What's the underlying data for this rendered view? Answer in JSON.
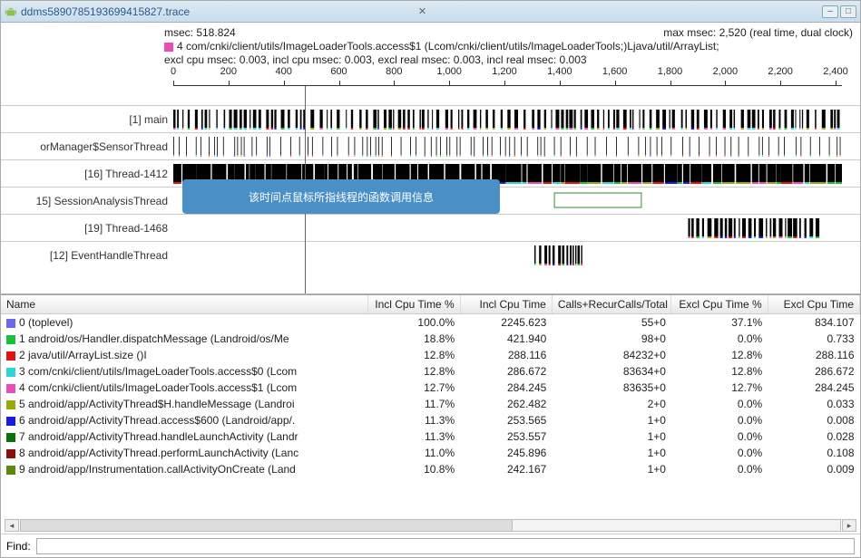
{
  "titlebar": {
    "title": "ddms5890785193699415827.trace"
  },
  "info": {
    "msec_label": "msec: 518.824",
    "max_msec": "max msec: 2,520 (real time, dual clock)",
    "method": "4 com/cnki/client/utils/ImageLoaderTools.access$1 (Lcom/cnki/client/utils/ImageLoaderTools;)Ljava/util/ArrayList;",
    "excl": "excl cpu msec: 0.003, incl cpu msec: 0.003, excl real msec: 0.003, incl real msec: 0.003"
  },
  "ruler_ticks": [
    "0",
    "200",
    "400",
    "600",
    "800",
    "1,000",
    "1,200",
    "1,400",
    "1,600",
    "1,800",
    "2,000",
    "2,200",
    "2,400"
  ],
  "callout_text": "该时间点鼠标所指线程的函数调用信息",
  "threads": [
    {
      "label": "[1] main",
      "pattern": "dense"
    },
    {
      "label": "orManager$SensorThread",
      "pattern": "sparse"
    },
    {
      "label": "[16] Thread-1412",
      "pattern": "solid"
    },
    {
      "label": "15] SessionAnalysisThread",
      "pattern": "seg",
      "seg_start": 0.57,
      "seg_end": 0.7
    },
    {
      "label": "[19] Thread-1468",
      "pattern": "cluster",
      "seg_start": 0.77,
      "seg_end": 0.97
    },
    {
      "label": "[12] EventHandleThread",
      "pattern": "small",
      "seg_start": 0.54,
      "seg_end": 0.61
    }
  ],
  "columns": [
    "Name",
    "Incl Cpu Time %",
    "Incl Cpu Time",
    "Calls+RecurCalls/Total",
    "Excl Cpu Time %",
    "Excl Cpu Time"
  ],
  "rows": [
    {
      "c": "#6a6ae8",
      "name": "0 (toplevel)",
      "itp": "100.0%",
      "it": "2245.623",
      "calls": "55+0",
      "etp": "37.1%",
      "et": "834.107"
    },
    {
      "c": "#1abf3a",
      "name": "1 android/os/Handler.dispatchMessage (Landroid/os/Me",
      "itp": "18.8%",
      "it": "421.940",
      "calls": "98+0",
      "etp": "0.0%",
      "et": "0.733"
    },
    {
      "c": "#e01313",
      "name": "2 java/util/ArrayList.size ()I",
      "itp": "12.8%",
      "it": "288.116",
      "calls": "84232+0",
      "etp": "12.8%",
      "et": "288.116"
    },
    {
      "c": "#2ad6d6",
      "name": "3 com/cnki/client/utils/ImageLoaderTools.access$0 (Lcom",
      "itp": "12.8%",
      "it": "286.672",
      "calls": "83634+0",
      "etp": "12.8%",
      "et": "286.672"
    },
    {
      "c": "#e84db5",
      "name": "4 com/cnki/client/utils/ImageLoaderTools.access$1 (Lcom",
      "itp": "12.7%",
      "it": "284.245",
      "calls": "83635+0",
      "etp": "12.7%",
      "et": "284.245"
    },
    {
      "c": "#9aa80a",
      "name": "5 android/app/ActivityThread$H.handleMessage (Landroi",
      "itp": "11.7%",
      "it": "262.482",
      "calls": "2+0",
      "etp": "0.0%",
      "et": "0.033"
    },
    {
      "c": "#1a1ae0",
      "name": "6 android/app/ActivityThread.access$600 (Landroid/app/.",
      "itp": "11.3%",
      "it": "253.565",
      "calls": "1+0",
      "etp": "0.0%",
      "et": "0.008"
    },
    {
      "c": "#0a7010",
      "name": "7 android/app/ActivityThread.handleLaunchActivity (Landr",
      "itp": "11.3%",
      "it": "253.557",
      "calls": "1+0",
      "etp": "0.0%",
      "et": "0.028"
    },
    {
      "c": "#8a1010",
      "name": "8 android/app/ActivityThread.performLaunchActivity (Lanc",
      "itp": "11.0%",
      "it": "245.896",
      "calls": "1+0",
      "etp": "0.0%",
      "et": "0.108"
    },
    {
      "c": "#5a8a0a",
      "name": "9 android/app/Instrumentation.callActivityOnCreate (Land",
      "itp": "10.8%",
      "it": "242.167",
      "calls": "1+0",
      "etp": "0.0%",
      "et": "0.009"
    }
  ],
  "find_label": "Find:"
}
